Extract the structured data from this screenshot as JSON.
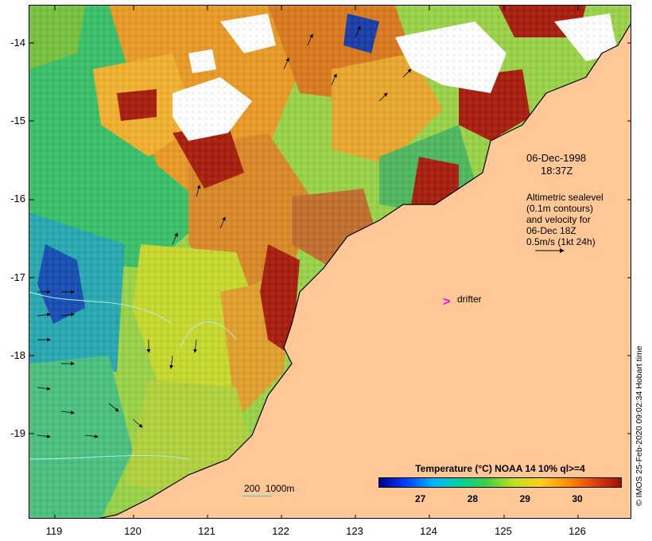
{
  "map": {
    "x_axis": {
      "min": 118.65,
      "max": 126.8,
      "ticks": [
        "119",
        "120",
        "121",
        "122",
        "123",
        "124",
        "125",
        "126"
      ]
    },
    "y_axis": {
      "min": -20.1,
      "max": -13.55,
      "ticks": [
        "-14",
        "-15",
        "-16",
        "-17",
        "-18",
        "-19"
      ]
    },
    "annotations": {
      "date": "06-Dec-1998",
      "time": "18:37Z",
      "legend_line1": "Altimetric sealevel",
      "legend_line2": "(0.1m contours)",
      "legend_line3": "and velocity for",
      "legend_line4": "06-Dec 18Z",
      "legend_line5": "0.5m/s (1kt 24h)",
      "drifter_label": "drifter",
      "drifter_marker": ">",
      "scale_label": "200  1000m"
    },
    "credit": "© IMOS 25-Feb-2020 09:02:34 Hobart time",
    "colorbar": {
      "title": "Temperature (°C) NOAA 14 10% ql>=4",
      "min": 26.2,
      "max": 30.85,
      "tick_labels": [
        "27",
        "28",
        "29",
        "30"
      ],
      "tick_values": [
        27,
        28,
        29,
        30
      ]
    },
    "colors": {
      "land": "#ffc896",
      "cloud": "#ffffff",
      "drifter": "#ff00ff",
      "contour": "#3cc8c8"
    }
  }
}
